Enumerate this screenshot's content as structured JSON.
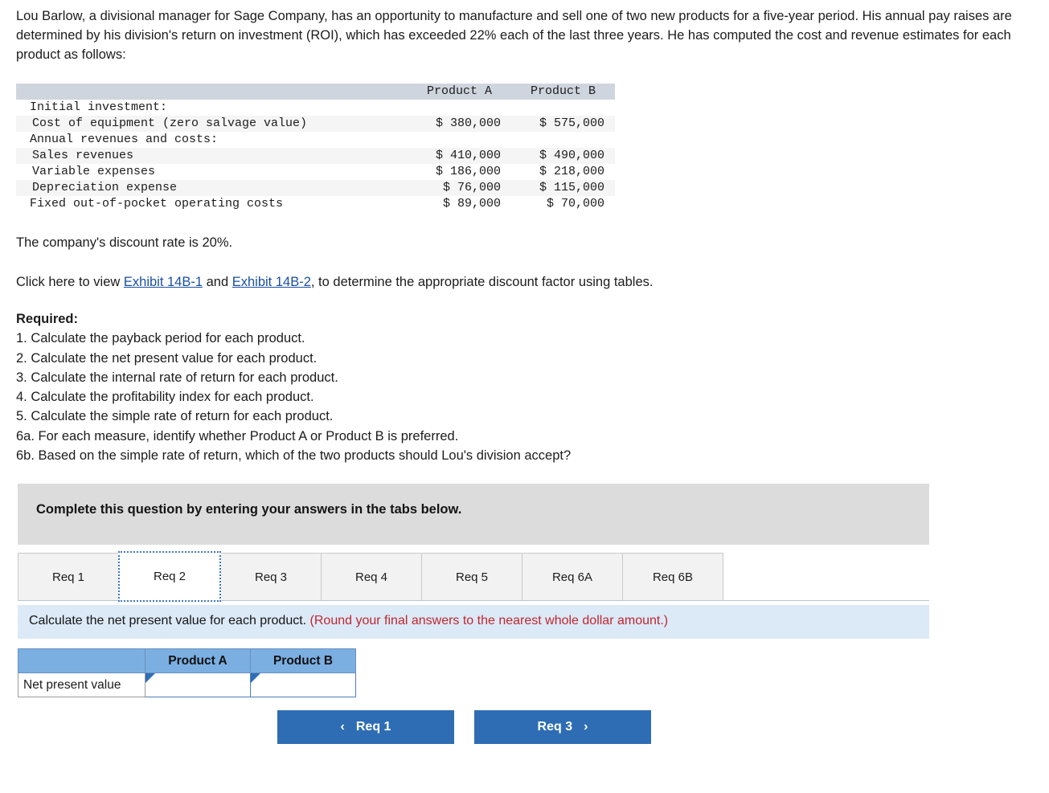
{
  "intro": "Lou Barlow, a divisional manager for Sage Company, has an opportunity to manufacture and sell one of two new products for a five-year period. His annual pay raises are determined by his division's return on investment (ROI), which has exceeded 22% each of the last three years. He has computed the cost and revenue estimates for each product as follows:",
  "data_table": {
    "headers": [
      "",
      "Product A",
      "Product B"
    ],
    "rows": [
      {
        "label": "Initial investment:",
        "indent": "group",
        "a": "",
        "b": ""
      },
      {
        "label": "Cost of equipment (zero salvage value)",
        "indent": "item",
        "a": "$ 380,000",
        "b": "$ 575,000"
      },
      {
        "label": "Annual revenues and costs:",
        "indent": "group",
        "a": "",
        "b": ""
      },
      {
        "label": "Sales revenues",
        "indent": "item",
        "a": "$ 410,000",
        "b": "$ 490,000"
      },
      {
        "label": "Variable expenses",
        "indent": "item",
        "a": "$ 186,000",
        "b": "$ 218,000"
      },
      {
        "label": "Depreciation expense",
        "indent": "item",
        "a": "$ 76,000",
        "b": "$ 115,000"
      },
      {
        "label": "Fixed out-of-pocket operating costs",
        "indent": "group",
        "a": "$ 89,000",
        "b": "$ 70,000"
      }
    ]
  },
  "discount_rate_line": "The company's discount rate is 20%.",
  "exhibit_line": {
    "before": "Click here to view ",
    "link1": "Exhibit 14B-1",
    "middle": " and ",
    "link2": "Exhibit 14B-2",
    "after": ", to determine the appropriate discount factor using tables."
  },
  "required": {
    "heading": "Required:",
    "items": [
      "1. Calculate the payback period for each product.",
      "2. Calculate the net present value for each product.",
      "3. Calculate the internal rate of return for each product.",
      "4. Calculate the profitability index for each product.",
      "5. Calculate the simple rate of return for each product.",
      "6a. For each measure, identify whether Product A or Product B is preferred.",
      "6b. Based on the simple rate of return, which of the two products should Lou's division accept?"
    ]
  },
  "gray_banner": "Complete this question by entering your answers in the tabs below.",
  "tabs": [
    {
      "label": "Req 1",
      "active": false
    },
    {
      "label": "Req 2",
      "active": true
    },
    {
      "label": "Req 3",
      "active": false
    },
    {
      "label": "Req 4",
      "active": false
    },
    {
      "label": "Req 5",
      "active": false
    },
    {
      "label": "Req 6A",
      "active": false
    },
    {
      "label": "Req 6B",
      "active": false
    }
  ],
  "instruction": {
    "text": "Calculate the net present value for each product. ",
    "note": "(Round your final answers to the nearest whole dollar amount.)"
  },
  "answer_table": {
    "headers": [
      "",
      "Product A",
      "Product B"
    ],
    "row_label": "Net present value",
    "value_a": "",
    "value_b": ""
  },
  "nav": {
    "prev_label": "Req 1",
    "prev_chevron": "‹",
    "next_label": "Req 3",
    "next_chevron": "›"
  },
  "colors": {
    "button_blue": "#2e6db4",
    "table_header_blue": "#7bafe2",
    "instruction_blue": "#dce9f7",
    "gray_banner": "#dcdcdc",
    "data_header_gray": "#cfd5de",
    "link_blue": "#1a4fa0",
    "note_red": "#c0272d"
  }
}
